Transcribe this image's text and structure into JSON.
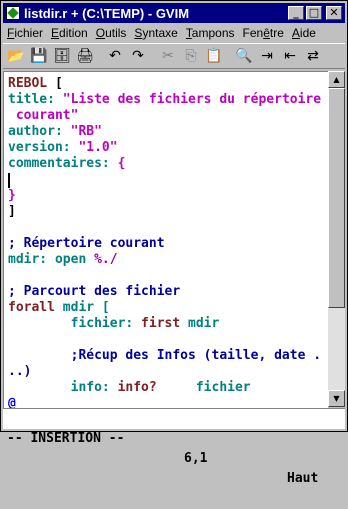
{
  "window": {
    "title": "listdir.r + (C:\\TEMP) - GVIM",
    "minimize": "_",
    "maximize": "□",
    "close": "✕"
  },
  "menu": [
    "Fichier",
    "Edition",
    "Outils",
    "Syntaxe",
    "Tampons",
    "Fenêtre",
    "Aide"
  ],
  "menu_mnemonic": [
    "F",
    "E",
    "O",
    "S",
    "T",
    "ê",
    "A"
  ],
  "toolbar": [
    {
      "name": "open-icon",
      "glyph": "📂"
    },
    {
      "name": "save-icon",
      "glyph": "💾"
    },
    {
      "name": "save-all-icon",
      "glyph": "🗄"
    },
    {
      "name": "print-icon",
      "glyph": "🖨"
    },
    {
      "name": "undo-icon",
      "glyph": "↶"
    },
    {
      "name": "redo-icon",
      "glyph": "↷"
    },
    {
      "name": "cut-icon",
      "glyph": "✂"
    },
    {
      "name": "copy-icon",
      "glyph": "⎘"
    },
    {
      "name": "paste-icon",
      "glyph": "📋"
    },
    {
      "name": "find-icon",
      "glyph": "🔍"
    },
    {
      "name": "find-next-icon",
      "glyph": "⇥"
    },
    {
      "name": "find-prev-icon",
      "glyph": "⇤"
    },
    {
      "name": "replace-icon",
      "glyph": "⇄"
    }
  ],
  "code": {
    "l1": {
      "a": "REBOL",
      "b": " ["
    },
    "l2": {
      "a": "title:",
      "b": " \"Liste des fichiers du répertoire"
    },
    "l3": {
      "a": " courant\""
    },
    "l4": {
      "a": "author:",
      "b": " \"RB\""
    },
    "l5": {
      "a": "version:",
      "b": " \"1.0\""
    },
    "l6": {
      "a": "commentaires:",
      "b": " {"
    },
    "l8": {
      "a": "}"
    },
    "l9": {
      "a": "]"
    },
    "l11": {
      "a": "; Répertoire courant"
    },
    "l12": {
      "a": "mdir:",
      "b": " open ",
      "c": "%./"
    },
    "l14": {
      "a": "; Parcourt des fichier"
    },
    "l15": {
      "a": "forall",
      "b": " mdir ["
    },
    "l16": {
      "a": "        fichier:",
      "b": " first",
      "c": " mdir"
    },
    "l18": {
      "a": "        ;Récup des Infos (taille, date ."
    },
    "l19": {
      "a": "..)"
    },
    "l20": {
      "a": "        info:",
      "b": " info?",
      "c": "     fichier"
    },
    "l21": {
      "a": "@"
    }
  },
  "status": {
    "mode": "-- INSERTION --",
    "position": "6,1",
    "scroll": "Haut"
  }
}
